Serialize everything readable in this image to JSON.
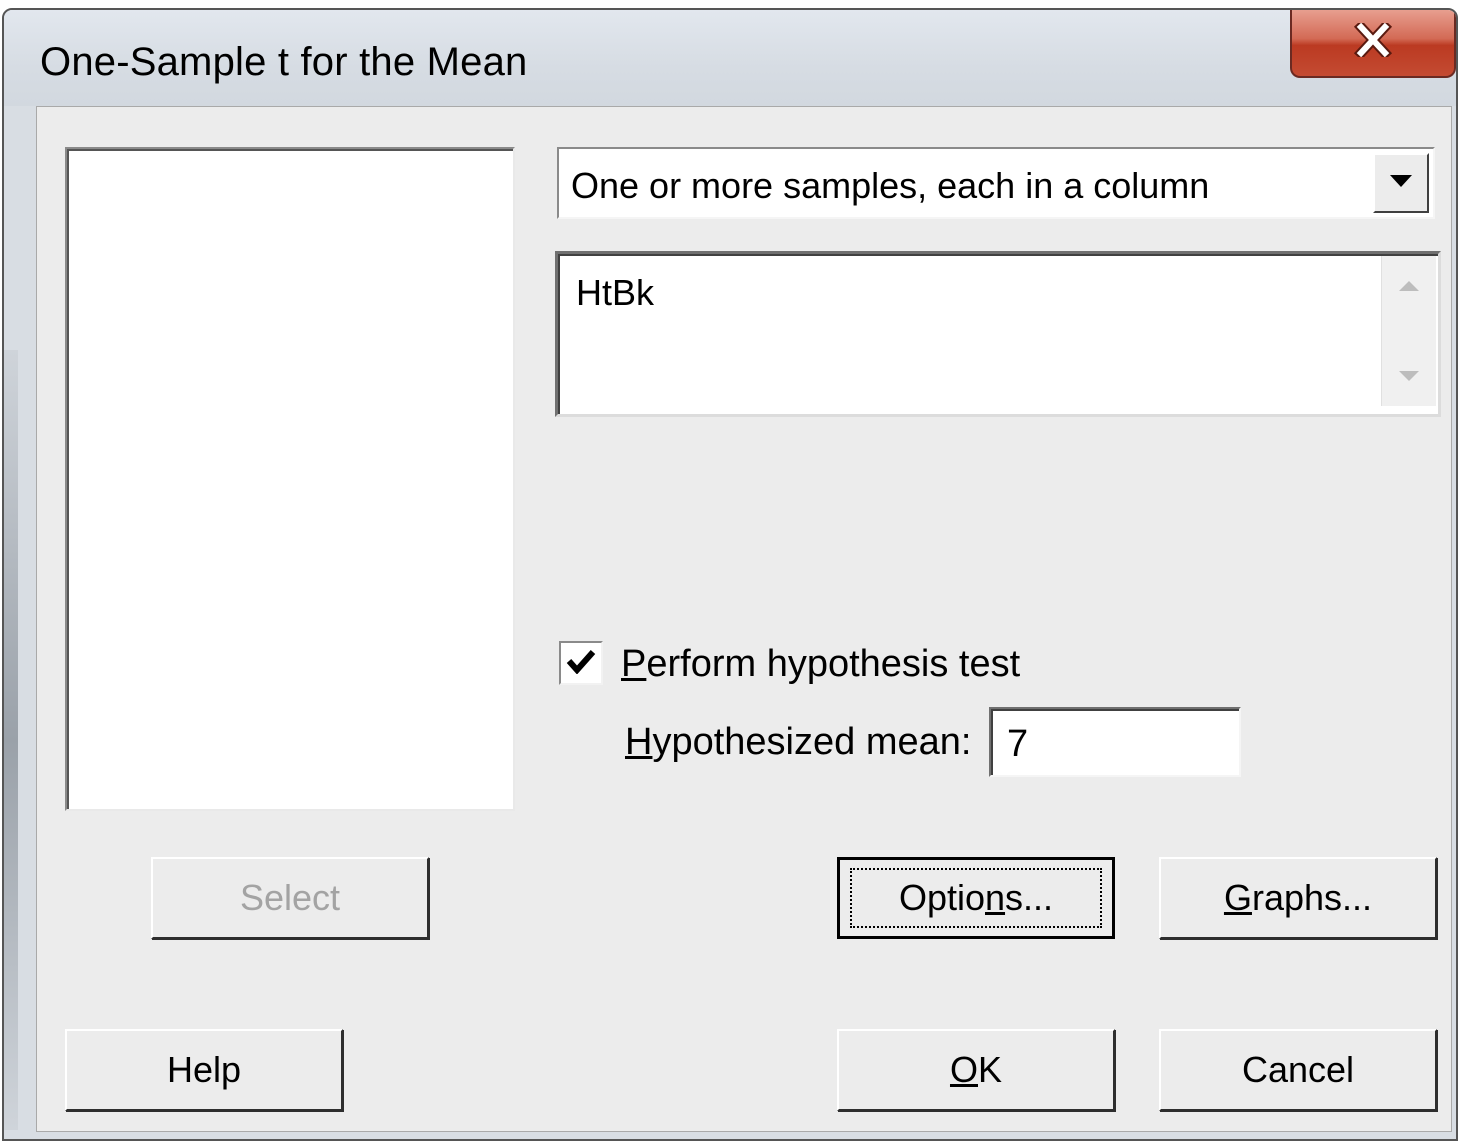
{
  "window": {
    "title": "One-Sample t for the Mean"
  },
  "icons": {
    "close": "close-icon",
    "dropdown": "chevron-down-icon",
    "scroll_up": "scroll-up-icon",
    "scroll_down": "scroll-down-icon",
    "check": "checkmark-icon"
  },
  "data_layout": {
    "selected": "One or more samples, each in a column"
  },
  "variables": {
    "value": "HtBk"
  },
  "hypothesis": {
    "checkbox_label_mnemonic": "P",
    "checkbox_label_rest": "erform hypothesis test",
    "checked": true,
    "mean_label_mnemonic": "H",
    "mean_label_rest": "ypothesized mean:",
    "mean_value": "7"
  },
  "buttons": {
    "select": "Select",
    "options_pre": "Optio",
    "options_mnemonic": "n",
    "options_post": "s...",
    "graphs_mnemonic": "G",
    "graphs_rest": "raphs...",
    "help": "Help",
    "ok_mnemonic": "O",
    "ok_rest": "K",
    "cancel": "Cancel"
  }
}
